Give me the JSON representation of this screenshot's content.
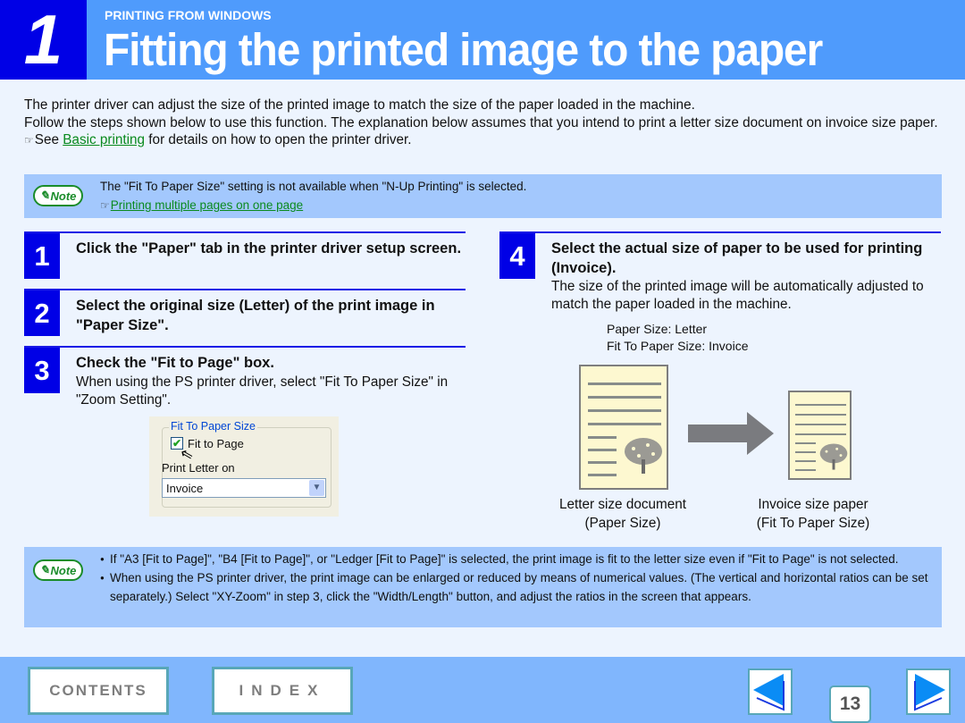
{
  "header": {
    "chapter_number": "1",
    "section_label": "PRINTING FROM WINDOWS",
    "title": "Fitting the printed image to the paper"
  },
  "intro": {
    "line1": "The printer driver can adjust the size of the printed image to match the size of the paper loaded in the machine.",
    "line2": "Follow the steps shown below to use this function. The explanation below assumes that you intend to print a letter size document on invoice size paper.",
    "see_prefix": "See ",
    "see_link": "Basic printing",
    "see_suffix": " for details on how to open the printer driver."
  },
  "note1": {
    "badge": "Note",
    "text": "The \"Fit To Paper Size\" setting is not available when \"N-Up Printing\" is selected.",
    "link": "Printing multiple pages on one page"
  },
  "steps": [
    {
      "number": "1",
      "title": "Click the \"Paper\" tab in the printer driver setup screen.",
      "body": ""
    },
    {
      "number": "2",
      "title": "Select the original size (Letter) of the print image in \"Paper Size\".",
      "body": ""
    },
    {
      "number": "3",
      "title": "Check the \"Fit to Page\" box.",
      "body": "When using the PS printer driver, select \"Fit To Paper Size\" in \"Zoom Setting\"."
    },
    {
      "number": "4",
      "title": "Select the actual size of paper to be used for printing (Invoice).",
      "body": "The size of the printed image will be automatically adjusted to match the paper loaded in the machine."
    }
  ],
  "dialog": {
    "group_label": "Fit To Paper Size",
    "checkbox_label": "Fit to Page",
    "checkbox_checked": true,
    "print_on_label": "Print Letter on",
    "select_value": "Invoice"
  },
  "paper_info": {
    "line1": "Paper Size: Letter",
    "line2": "Fit To Paper Size: Invoice"
  },
  "illustration": {
    "left_caption_1": "Letter size document",
    "left_caption_2": "(Paper Size)",
    "right_caption_1": "Invoice size paper",
    "right_caption_2": "(Fit To Paper Size)"
  },
  "note2": {
    "badge": "Note",
    "bullets": [
      "If \"A3 [Fit to Page]\", \"B4 [Fit to Page]\", or \"Ledger [Fit to Page]\" is selected, the print image is fit to the letter size even if \"Fit to Page\" is not selected.",
      "When using the PS printer driver, the print image can be enlarged or reduced by means of numerical values. (The vertical and horizontal ratios can be set separately.) Select \"XY-Zoom\" in step 3, click the \"Width/Length\" button, and adjust the ratios in the screen that appears."
    ]
  },
  "footer": {
    "contents_label": "CONTENTS",
    "index_label": "INDEX",
    "page_number": "13"
  },
  "colors": {
    "header_blue": "#4F9BFC",
    "chapter_blue": "#0000E6",
    "note_bg": "#A3C8FD",
    "link_green": "#0A8A1E",
    "footer_blue": "#80B6FD"
  }
}
